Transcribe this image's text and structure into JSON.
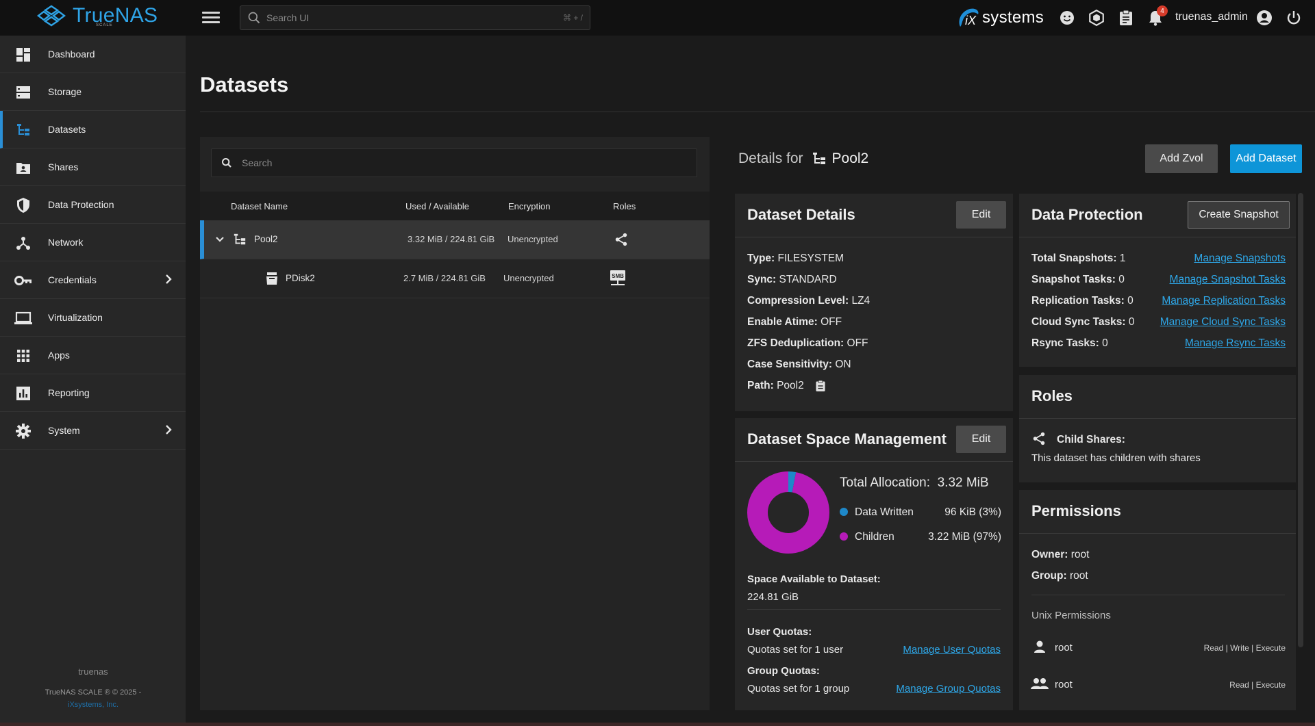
{
  "app": {
    "name": "TrueNAS",
    "edition": "SCALE",
    "search_placeholder": "Search UI",
    "search_shortcut": "⌘ + /",
    "vendor": "systems",
    "notification_count": "4",
    "username": "truenas_admin"
  },
  "sidebar": {
    "items": [
      {
        "label": "Dashboard"
      },
      {
        "label": "Storage"
      },
      {
        "label": "Datasets"
      },
      {
        "label": "Shares"
      },
      {
        "label": "Data Protection"
      },
      {
        "label": "Network"
      },
      {
        "label": "Credentials"
      },
      {
        "label": "Virtualization"
      },
      {
        "label": "Apps"
      },
      {
        "label": "Reporting"
      },
      {
        "label": "System"
      }
    ],
    "hostname": "truenas",
    "copyright": "TrueNAS SCALE ® © 2025 -",
    "company": "iXsystems, Inc."
  },
  "page": {
    "title": "Datasets"
  },
  "tree": {
    "search_placeholder": "Search",
    "columns": [
      "Dataset Name",
      "Used / Available",
      "Encryption",
      "Roles"
    ],
    "rows": [
      {
        "name": "Pool2",
        "usage": "3.32 MiB / 224.81 GiB",
        "encryption": "Unencrypted",
        "role_icon": "share-icon"
      },
      {
        "name": "PDisk2",
        "usage": "2.7 MiB / 224.81 GiB",
        "encryption": "Unencrypted",
        "role_icon": "smb-icon",
        "role_label": "SMB"
      }
    ]
  },
  "details": {
    "prefix": "Details for",
    "name": "Pool2",
    "add_zvol": "Add Zvol",
    "add_dataset": "Add Dataset"
  },
  "dataset_details": {
    "title": "Dataset Details",
    "edit": "Edit",
    "fields": [
      {
        "label": "Type:",
        "value": "FILESYSTEM"
      },
      {
        "label": "Sync:",
        "value": "STANDARD"
      },
      {
        "label": "Compression Level:",
        "value": "LZ4"
      },
      {
        "label": "Enable Atime:",
        "value": "OFF"
      },
      {
        "label": "ZFS Deduplication:",
        "value": "OFF"
      },
      {
        "label": "Case Sensitivity:",
        "value": "ON"
      },
      {
        "label": "Path:",
        "value": "Pool2"
      }
    ]
  },
  "space": {
    "title": "Dataset Space Management",
    "edit": "Edit",
    "total_label": "Total Allocation:",
    "total_value": "3.32 MiB",
    "legend": [
      {
        "label": "Data Written",
        "value": "96 KiB (3%)",
        "color": "#1e88c9",
        "percent": 3
      },
      {
        "label": "Children",
        "value": "3.22 MiB (97%)",
        "color": "#b61bb8",
        "percent": 97
      }
    ],
    "available_label": "Space Available to Dataset:",
    "available_value": "224.81 GiB",
    "user_quotas_label": "User Quotas:",
    "user_quotas_value": "Quotas set for 1 user",
    "user_quotas_link": "Manage User Quotas",
    "group_quotas_label": "Group Quotas:",
    "group_quotas_value": "Quotas set for 1 group",
    "group_quotas_link": "Manage Group Quotas"
  },
  "protection": {
    "title": "Data Protection",
    "create_snapshot": "Create Snapshot",
    "rows": [
      {
        "label": "Total Snapshots:",
        "value": "1",
        "link": "Manage Snapshots"
      },
      {
        "label": "Snapshot Tasks:",
        "value": "0",
        "link": "Manage Snapshot Tasks"
      },
      {
        "label": "Replication Tasks:",
        "value": "0",
        "link": "Manage Replication Tasks"
      },
      {
        "label": "Cloud Sync Tasks:",
        "value": "0",
        "link": "Manage Cloud Sync Tasks"
      },
      {
        "label": "Rsync Tasks:",
        "value": "0",
        "link": "Manage Rsync Tasks"
      }
    ]
  },
  "roles": {
    "title": "Roles",
    "child_shares_label": "Child Shares:",
    "child_shares_text": "This dataset has children with shares"
  },
  "permissions": {
    "title": "Permissions",
    "owner_label": "Owner:",
    "owner": "root",
    "group_label": "Group:",
    "group": "root",
    "unix_label": "Unix Permissions",
    "entries": [
      {
        "name": "root",
        "perms": "Read | Write | Execute",
        "icon": "user-icon"
      },
      {
        "name": "root",
        "perms": "Read | Execute",
        "icon": "group-icon"
      }
    ]
  }
}
